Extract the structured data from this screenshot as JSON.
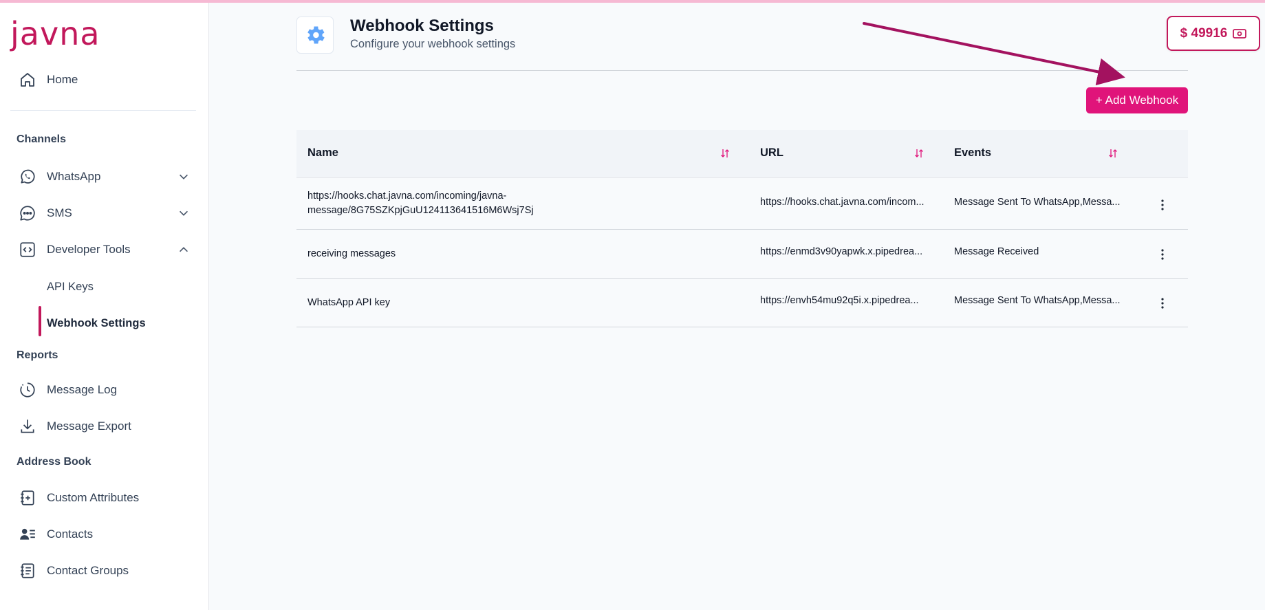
{
  "brand": {
    "logo_text": "javna"
  },
  "sidebar": {
    "home": "Home",
    "channels_title": "Channels",
    "channels": [
      {
        "label": "WhatsApp"
      },
      {
        "label": "SMS"
      },
      {
        "label": "Developer Tools"
      }
    ],
    "developer_sub": [
      {
        "label": "API Keys"
      },
      {
        "label": "Webhook Settings",
        "active": true
      }
    ],
    "reports_title": "Reports",
    "reports": [
      {
        "label": "Message Log"
      },
      {
        "label": "Message Export"
      }
    ],
    "address_title": "Address Book",
    "address": [
      {
        "label": "Custom Attributes"
      },
      {
        "label": "Contacts"
      },
      {
        "label": "Contact Groups"
      }
    ]
  },
  "header": {
    "title": "Webhook Settings",
    "subtitle": "Configure your webhook settings"
  },
  "balance": {
    "text": "$ 49916"
  },
  "actions": {
    "add_webhook": "+ Add Webhook"
  },
  "table": {
    "columns": [
      "Name",
      "URL",
      "Events"
    ],
    "rows": [
      {
        "name_line1": "https://hooks.chat.javna.com/incoming/javna-",
        "name_line2": "message/8G75SZKpjGuU124113641516M6Wsj7Sj",
        "url": "https://hooks.chat.javna.com/incom...",
        "events": "Message Sent To WhatsApp,Messa..."
      },
      {
        "name_line1": "receiving messages",
        "name_line2": "",
        "url": "https://enmd3v90yapwk.x.pipedrea...",
        "events": "Message Received"
      },
      {
        "name_line1": "WhatsApp API key",
        "name_line2": "",
        "url": "https://envh54mu92q5i.x.pipedrea...",
        "events": "Message Sent To WhatsApp,Messa..."
      }
    ]
  },
  "colors": {
    "brand": "#c2185b",
    "button": "#e0147a",
    "annotation_arrow": "#a3125f"
  }
}
